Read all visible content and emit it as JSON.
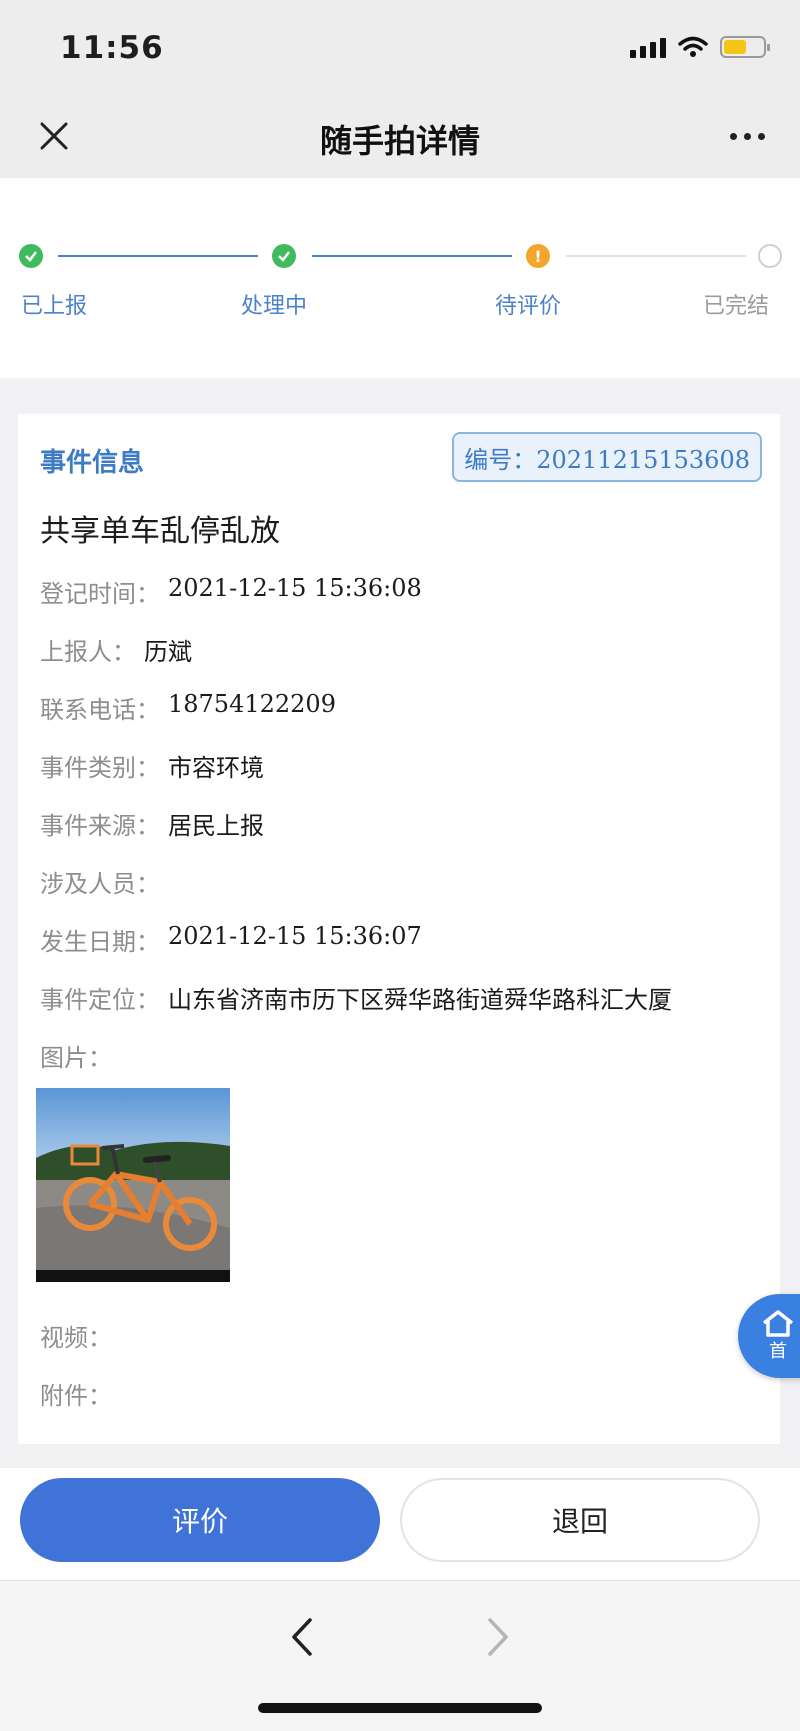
{
  "status_bar": {
    "time": "11:56"
  },
  "nav": {
    "title": "随手拍详情"
  },
  "steps": [
    {
      "label": "已上报",
      "state": "done"
    },
    {
      "label": "处理中",
      "state": "done"
    },
    {
      "label": "待评价",
      "state": "current"
    },
    {
      "label": "已完结",
      "state": "pending"
    }
  ],
  "colors": {
    "done": "#3fba5c",
    "current": "#f4a52a",
    "pending": "#cfcfcf",
    "accent": "#3f73d8",
    "link": "#3d7cc4"
  },
  "event": {
    "section_title": "事件信息",
    "code": "编号：20211215153608",
    "title": "共享单车乱停乱放",
    "fields": [
      {
        "label": "登记时间：",
        "value": "2021-12-15 15:36:08"
      },
      {
        "label": "上报人：",
        "value": "历斌"
      },
      {
        "label": "联系电话：",
        "value": "18754122209"
      },
      {
        "label": "事件类别：",
        "value": "市容环境"
      },
      {
        "label": "事件来源：",
        "value": "居民上报"
      },
      {
        "label": "涉及人员：",
        "value": ""
      },
      {
        "label": "发生日期：",
        "value": "2021-12-15 15:36:07"
      },
      {
        "label": "事件定位：",
        "value": "山东省济南市历下区舜华路街道舜华路科汇大厦"
      },
      {
        "label": "图片：",
        "value": ""
      }
    ],
    "video_label": "视频：",
    "attachment_label": "附件："
  },
  "home_float": {
    "label": "首"
  },
  "actions": {
    "rate_label": "评价",
    "return_label": "退回"
  }
}
